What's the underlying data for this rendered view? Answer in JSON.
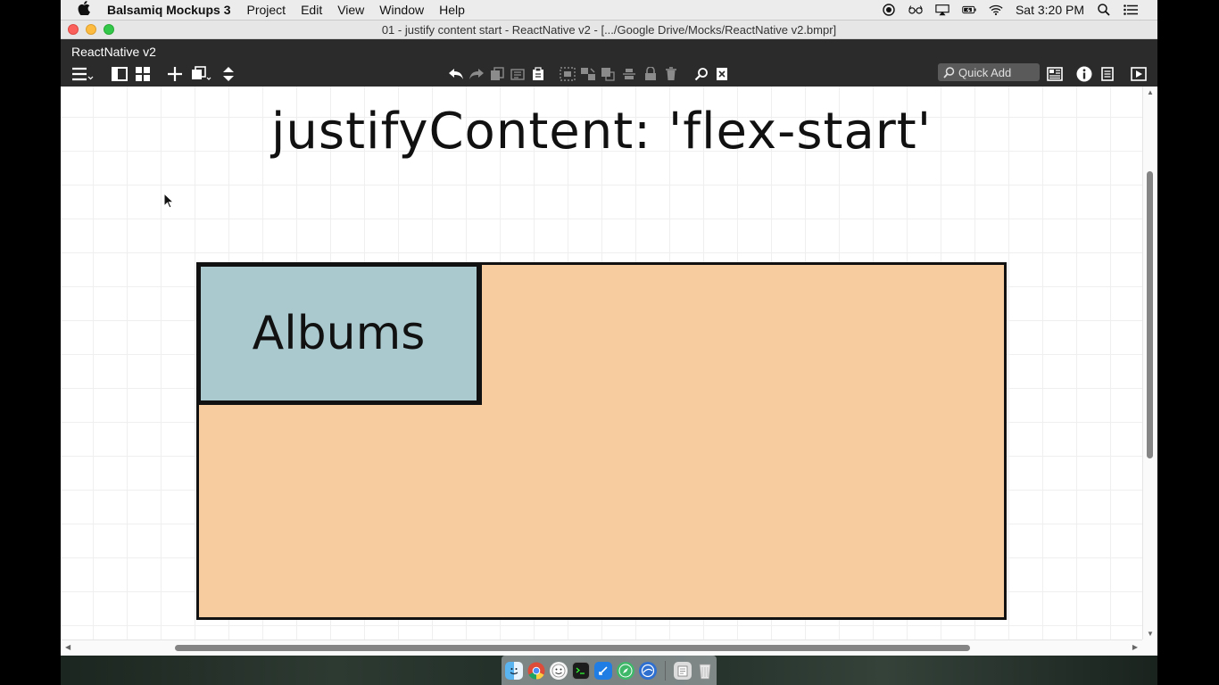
{
  "menubar": {
    "apple_icon": "apple-logo-icon",
    "app_name": "Balsamiq Mockups 3",
    "menus": [
      "Project",
      "Edit",
      "View",
      "Window",
      "Help"
    ],
    "status_icons": [
      "screen-record-icon",
      "glasses-icon",
      "airplay-icon",
      "battery-icon",
      "wifi-icon"
    ],
    "clock": "Sat 3:20 PM",
    "right_icons": [
      "spotlight-search-icon",
      "notification-list-icon"
    ]
  },
  "window": {
    "title": "01 - justify content start - ReactNative v2 - [.../Google Drive/Mocks/ReactNative v2.bmpr]"
  },
  "toolbar": {
    "project_name": "ReactNative v2",
    "quick_add_placeholder": "Quick Add"
  },
  "mockup": {
    "title": "justifyContent: 'flex-start'",
    "box_label": "Albums",
    "colors": {
      "container": "#f7cc9f",
      "box": "#a9c9ce",
      "border": "#111111"
    }
  },
  "dock": {
    "apps": [
      "finder-icon",
      "chrome-icon",
      "messages-icon",
      "terminal-icon",
      "xcode-icon",
      "safari-icon",
      "simulator-icon",
      "documents-folder-icon",
      "trash-icon"
    ]
  }
}
